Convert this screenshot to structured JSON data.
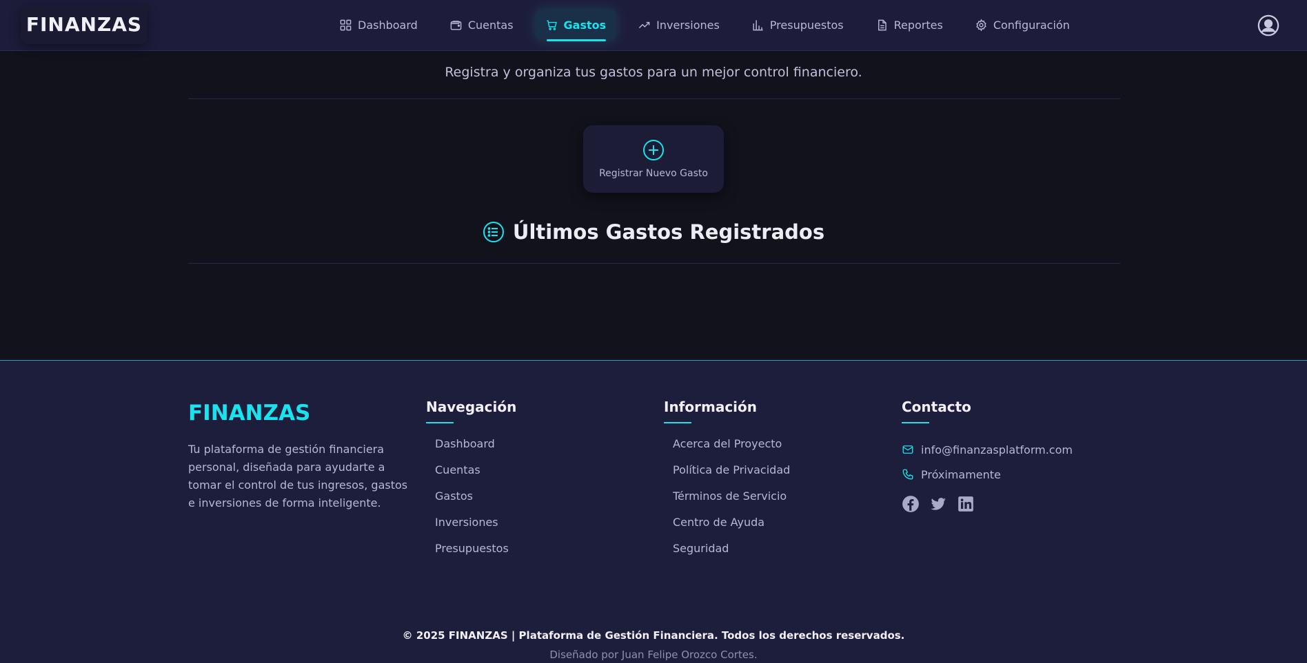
{
  "header": {
    "brand": "FINANZAS",
    "nav": [
      {
        "label": "Dashboard",
        "icon": "grid-icon"
      },
      {
        "label": "Cuentas",
        "icon": "wallet-icon"
      },
      {
        "label": "Gastos",
        "icon": "cart-icon",
        "active": true
      },
      {
        "label": "Inversiones",
        "icon": "trend-icon"
      },
      {
        "label": "Presupuestos",
        "icon": "bar-chart-icon"
      },
      {
        "label": "Reportes",
        "icon": "document-icon"
      },
      {
        "label": "Configuración",
        "icon": "gear-icon"
      }
    ],
    "profile_icon": "user-circle-icon"
  },
  "main": {
    "subtitle": "Registra y organiza tus gastos para un mejor control financiero.",
    "new_expense_label": "Registrar Nuevo Gasto",
    "recent_title": "Últimos Gastos Registrados"
  },
  "footer": {
    "brand": "FINANZAS",
    "description": "Tu plataforma de gestión financiera personal, diseñada para ayudarte a tomar el control de tus ingresos, gastos e inversiones de forma inteligente.",
    "nav_title": "Navegación",
    "nav_links": [
      "Dashboard",
      "Cuentas",
      "Gastos",
      "Inversiones",
      "Presupuestos"
    ],
    "info_title": "Información",
    "info_links": [
      "Acerca del Proyecto",
      "Política de Privacidad",
      "Términos de Servicio",
      "Centro de Ayuda",
      "Seguridad"
    ],
    "contact_title": "Contacto",
    "email": "info@finanzasplatform.com",
    "phone": "Próximamente",
    "socials": [
      "facebook-icon",
      "twitter-icon",
      "linkedin-icon"
    ],
    "copyright": "© 2025 FINANZAS | Plataforma de Gestión Financiera. Todos los derechos reservados.",
    "credit": "Diseñado por Juan Felipe Orozco Cortes."
  },
  "colors": {
    "accent": "#19e3ef",
    "header_bg": "#1d1d3b",
    "page_bg": "#12121c",
    "footer_bg": "#1d1d3c"
  }
}
